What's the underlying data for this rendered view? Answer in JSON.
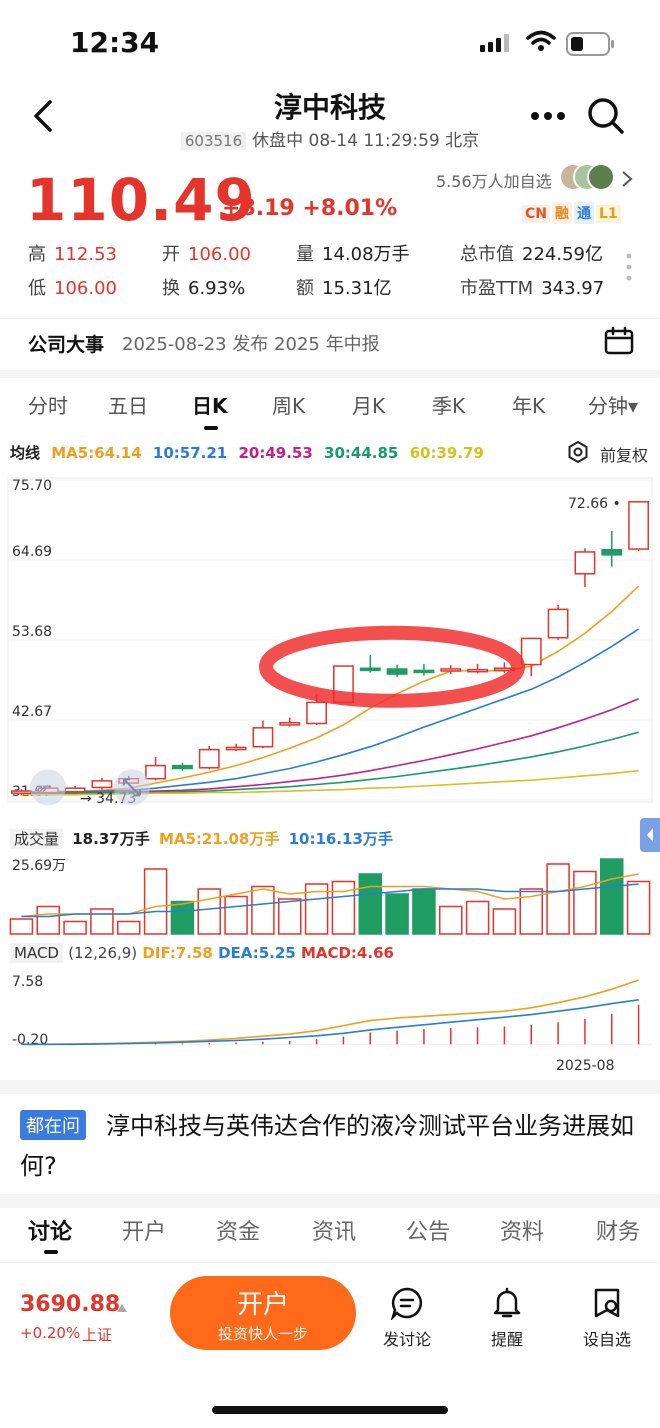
{
  "status_bar": {
    "time": "12:34"
  },
  "header": {
    "name": "淳中科技",
    "code": "603516",
    "status": "休盘中 08-14 11:29:59 北京"
  },
  "quote": {
    "price": "110.49",
    "change": "+8.19",
    "change_pct": "+8.01%",
    "watchers": "5.56万人加自选",
    "tags": [
      "CN",
      "融",
      "通",
      "L1"
    ],
    "stats": [
      {
        "k": "高",
        "v": "112.53",
        "color": "red"
      },
      {
        "k": "开",
        "v": "106.00",
        "color": "red"
      },
      {
        "k": "量",
        "v": "14.08万手",
        "color": "normal"
      },
      {
        "k": "总市值",
        "v": "224.59亿",
        "color": "normal"
      },
      {
        "k": "低",
        "v": "106.00",
        "color": "red"
      },
      {
        "k": "换",
        "v": "6.93%",
        "color": "normal"
      },
      {
        "k": "额",
        "v": "15.31亿",
        "color": "normal"
      },
      {
        "k": "市盈TTM",
        "v": "343.97",
        "color": "normal"
      }
    ]
  },
  "event": {
    "title": "公司大事",
    "text": "2025-08-23 发布 2025 年中报"
  },
  "period_tabs": [
    "分时",
    "五日",
    "日K",
    "周K",
    "月K",
    "季K",
    "年K",
    "分钟▾"
  ],
  "active_period": "日K",
  "ma_legend": {
    "label": "均线",
    "items": [
      {
        "text": "MA5:64.14",
        "color": "#f0a020"
      },
      {
        "text": "10:57.21",
        "color": "#2b7bd8"
      },
      {
        "text": "20:49.53",
        "color": "#c0208c"
      },
      {
        "text": "30:44.85",
        "color": "#1a9a6a"
      },
      {
        "text": "60:39.79",
        "color": "#d8c020"
      }
    ],
    "fuquan": "前复权"
  },
  "chart_data": [
    {
      "type": "candlestick",
      "y_ticks": [
        "75.70",
        "64.69",
        "53.68",
        "42.67",
        "31.67"
      ],
      "ylim": [
        31.67,
        75.7
      ],
      "annotations": {
        "high_label": "72.66",
        "low_label": "34.73"
      },
      "candles": [
        {
          "o": 32.6,
          "c": 32.9,
          "h": 33.2,
          "l": 32.3
        },
        {
          "o": 32.7,
          "c": 33.3,
          "h": 33.6,
          "l": 32.5
        },
        {
          "o": 32.8,
          "c": 33.3,
          "h": 33.6,
          "l": 32.6
        },
        {
          "o": 33.4,
          "c": 34.3,
          "h": 34.7,
          "l": 33.1
        },
        {
          "o": 34.0,
          "c": 34.6,
          "h": 35.0,
          "l": 33.8
        },
        {
          "o": 34.6,
          "c": 36.4,
          "h": 37.6,
          "l": 34.4
        },
        {
          "o": 36.4,
          "c": 36.0,
          "h": 36.8,
          "l": 35.7
        },
        {
          "o": 36.1,
          "c": 38.6,
          "h": 39.1,
          "l": 35.9
        },
        {
          "o": 38.6,
          "c": 38.9,
          "h": 39.4,
          "l": 38.4
        },
        {
          "o": 39.0,
          "c": 41.6,
          "h": 42.6,
          "l": 38.8
        },
        {
          "o": 42.0,
          "c": 42.3,
          "h": 43.0,
          "l": 41.8
        },
        {
          "o": 42.2,
          "c": 45.1,
          "h": 46.2,
          "l": 42.0
        },
        {
          "o": 45.1,
          "c": 50.1,
          "h": 50.1,
          "l": 45.0
        },
        {
          "o": 49.8,
          "c": 49.5,
          "h": 51.6,
          "l": 49.2
        },
        {
          "o": 49.7,
          "c": 49.0,
          "h": 50.3,
          "l": 48.6
        },
        {
          "o": 49.5,
          "c": 49.4,
          "h": 50.4,
          "l": 48.8
        },
        {
          "o": 49.6,
          "c": 49.7,
          "h": 50.2,
          "l": 49.0
        },
        {
          "o": 49.5,
          "c": 49.6,
          "h": 50.4,
          "l": 49.1
        },
        {
          "o": 49.6,
          "c": 49.8,
          "h": 50.6,
          "l": 49.2
        },
        {
          "o": 50.3,
          "c": 53.9,
          "h": 54.0,
          "l": 48.7
        },
        {
          "o": 54.0,
          "c": 57.9,
          "h": 58.5,
          "l": 53.7
        },
        {
          "o": 62.8,
          "c": 65.8,
          "h": 66.3,
          "l": 61.0
        },
        {
          "o": 66.1,
          "c": 65.4,
          "h": 68.7,
          "l": 63.8
        },
        {
          "o": 66.2,
          "c": 72.7,
          "h": 72.7,
          "l": 65.9
        }
      ],
      "ma_series": [
        {
          "name": "MA5",
          "color": "#f0a020",
          "values": [
            32.8,
            32.8,
            32.9,
            33.0,
            33.3,
            34.0,
            34.7,
            35.5,
            36.4,
            37.5,
            38.8,
            40.2,
            42.0,
            44.3,
            46.3,
            48.0,
            49.4,
            49.5,
            49.4,
            50.1,
            52.1,
            54.6,
            57.6,
            61.1
          ]
        },
        {
          "name": "MA10",
          "color": "#2b7bd8",
          "values": [
            32.7,
            32.7,
            32.8,
            32.9,
            33.0,
            33.3,
            33.7,
            34.1,
            34.6,
            35.3,
            36.0,
            36.9,
            37.9,
            39.0,
            40.3,
            41.7,
            43.0,
            44.3,
            45.6,
            46.9,
            48.6,
            50.6,
            52.8,
            55.2
          ]
        },
        {
          "name": "MA20",
          "color": "#c0208c",
          "values": [
            32.6,
            32.6,
            32.7,
            32.7,
            32.8,
            32.9,
            33.0,
            33.2,
            33.5,
            33.8,
            34.2,
            34.6,
            35.1,
            35.7,
            36.4,
            37.1,
            37.9,
            38.7,
            39.6,
            40.5,
            41.6,
            42.8,
            44.1,
            45.6
          ]
        },
        {
          "name": "MA30",
          "color": "#1a9a6a",
          "values": [
            32.5,
            32.5,
            32.6,
            32.6,
            32.7,
            32.7,
            32.8,
            32.9,
            33.1,
            33.3,
            33.5,
            33.8,
            34.1,
            34.5,
            34.9,
            35.4,
            35.9,
            36.4,
            37.0,
            37.6,
            38.3,
            39.1,
            40.0,
            41.0
          ]
        },
        {
          "name": "MA60",
          "color": "#d8c020",
          "values": [
            32.4,
            32.4,
            32.4,
            32.5,
            32.5,
            32.6,
            32.6,
            32.7,
            32.7,
            32.8,
            32.9,
            33.0,
            33.1,
            33.3,
            33.4,
            33.6,
            33.8,
            34.0,
            34.2,
            34.4,
            34.7,
            35.0,
            35.3,
            35.7
          ]
        }
      ]
    },
    {
      "type": "bar",
      "title": "成交量",
      "y_tick": "25.69万",
      "legend": [
        {
          "text": "18.37万手",
          "color": "#222"
        },
        {
          "text": "MA5:21.08万手",
          "color": "#f0a020"
        },
        {
          "text": "10:16.13万手",
          "color": "#2b7bd8"
        }
      ],
      "values": [
        6,
        11,
        5,
        10,
        5,
        26,
        13,
        18,
        15,
        19,
        14,
        20,
        21,
        24,
        16,
        18,
        11,
        13,
        10,
        18,
        28,
        25,
        30,
        21
      ],
      "ylim": [
        0,
        32
      ],
      "ma5": [
        7,
        8,
        8,
        8,
        8,
        11,
        12,
        14,
        16,
        18,
        16,
        17,
        17,
        19,
        19,
        19,
        18,
        17,
        14,
        15,
        17,
        19,
        22,
        24
      ],
      "ma10": [
        7,
        7,
        8,
        8,
        8,
        9,
        9,
        10,
        11,
        12,
        13,
        14,
        15,
        16,
        17,
        18,
        18,
        18,
        17,
        17,
        17,
        18,
        19,
        20
      ]
    },
    {
      "type": "bar",
      "title": "MACD",
      "params": "(12,26,9)",
      "legend": [
        {
          "text": "DIF:7.58",
          "color": "#f0a020"
        },
        {
          "text": "DEA:5.25",
          "color": "#2b7bd8"
        },
        {
          "text": "MACD:4.66",
          "color": "#e5342b"
        }
      ],
      "y_ticks": [
        "7.58",
        "-0.20"
      ],
      "ylim": [
        -0.2,
        7.58
      ],
      "x_label": "2025-08",
      "hist": [
        0,
        0,
        0,
        0,
        0.05,
        0.1,
        0.1,
        0.15,
        0.2,
        0.3,
        0.4,
        0.6,
        0.9,
        1.4,
        1.6,
        1.8,
        1.9,
        2.0,
        2.1,
        2.3,
        2.6,
        3.0,
        3.6,
        4.66
      ],
      "dif": [
        0,
        0,
        0.05,
        0.1,
        0.15,
        0.25,
        0.35,
        0.5,
        0.7,
        0.95,
        1.2,
        1.6,
        2.2,
        2.8,
        3.1,
        3.3,
        3.5,
        3.7,
        3.9,
        4.3,
        4.9,
        5.6,
        6.5,
        7.58
      ],
      "dea": [
        0,
        0,
        0,
        0.05,
        0.1,
        0.15,
        0.25,
        0.35,
        0.45,
        0.6,
        0.8,
        1.0,
        1.3,
        1.7,
        2.0,
        2.3,
        2.6,
        2.9,
        3.2,
        3.5,
        3.9,
        4.3,
        4.8,
        5.25
      ]
    }
  ],
  "question": {
    "badge": "都在问",
    "text": "淳中科技与英伟达合作的液冷测试平台业务进展如何?"
  },
  "bottom_tabs": [
    "讨论",
    "开户",
    "资金",
    "资讯",
    "公告",
    "资料",
    "财务"
  ],
  "footer": {
    "index_value": "3690.88",
    "index_change": "+0.20%",
    "index_name": "上证",
    "open_account": "开户",
    "open_account_sub": "投资快人一步",
    "tools": [
      "发讨论",
      "提醒",
      "设自选"
    ]
  }
}
